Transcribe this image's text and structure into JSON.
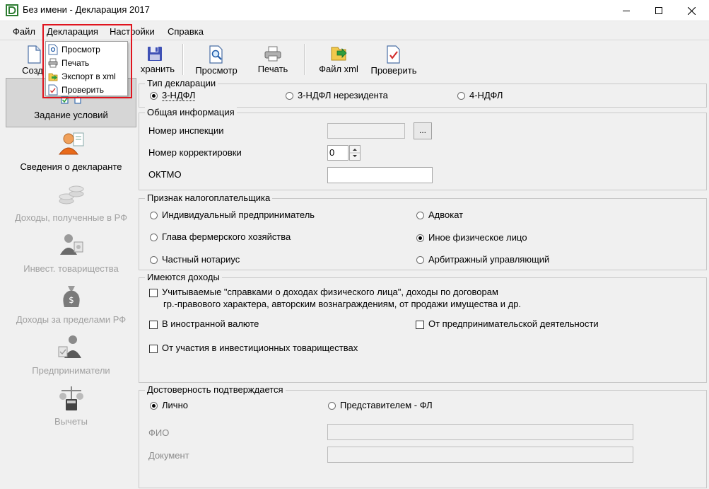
{
  "window": {
    "title": "Без имени - Декларация 2017",
    "controls": [
      "minimize",
      "maximize",
      "close"
    ]
  },
  "menubar": {
    "items": [
      "Файл",
      "Декларация",
      "Настройки",
      "Справка"
    ]
  },
  "dropdown": {
    "items": [
      {
        "label": "Просмотр",
        "icon": "preview-doc-icon"
      },
      {
        "label": "Печать",
        "icon": "printer-icon"
      },
      {
        "label": "Экспорт в xml",
        "icon": "export-xml-icon"
      },
      {
        "label": "Проверить",
        "icon": "check-doc-icon"
      }
    ]
  },
  "toolbar": {
    "create_label": "Созд",
    "save_label": "хранить",
    "preview_label": "Просмотр",
    "print_label": "Печать",
    "xml_label": "Файл xml",
    "check_label": "Проверить"
  },
  "leftnav": {
    "items": [
      {
        "label": "Задание условий",
        "enabled": true,
        "active": true
      },
      {
        "label": "Сведения о декларанте",
        "enabled": true,
        "active": false
      },
      {
        "label": "Доходы, полученные в РФ",
        "enabled": false,
        "active": false
      },
      {
        "label": "Инвест. товарищества",
        "enabled": false,
        "active": false
      },
      {
        "label": "Доходы за пределами РФ",
        "enabled": false,
        "active": false
      },
      {
        "label": "Предприниматели",
        "enabled": false,
        "active": false
      },
      {
        "label": "Вычеты",
        "enabled": false,
        "active": false
      }
    ]
  },
  "decl_type": {
    "title": "Тип декларации",
    "options": [
      "3-НДФЛ",
      "3-НДФЛ нерезидента",
      "4-НДФЛ"
    ],
    "selected": "3-НДФЛ"
  },
  "general": {
    "title": "Общая информация",
    "inspection_label": "Номер инспекции",
    "inspection_value": "",
    "browse_label": "...",
    "correction_label": "Номер корректировки",
    "correction_value": "0",
    "oktmo_label": "ОКТМО",
    "oktmo_value": ""
  },
  "taxpayer": {
    "title": "Признак налогоплательщика",
    "options": [
      "Индивидуальный предприниматель",
      "Адвокат",
      "Глава фермерского хозяйства",
      "Иное физическое лицо",
      "Частный нотариус",
      "Арбитражный управляющий"
    ],
    "selected": "Иное физическое лицо"
  },
  "income": {
    "title": "Имеются доходы",
    "item1_line1": "Учитываемые \"справками о доходах физического лица\", доходы по договорам",
    "item1_line2": "гр.-правового характера, авторским вознаграждениям, от продажи имущества и др.",
    "item2": "В иностранной валюте",
    "item3": "От предпринимательской деятельности",
    "item4": "От участия в инвестиционных товариществах",
    "checked": []
  },
  "confirm": {
    "title": "Достоверность подтверждается",
    "options": [
      "Лично",
      "Представителем - ФЛ"
    ],
    "selected": "Лично",
    "fio_label": "ФИО",
    "fio_value": "",
    "doc_label": "Документ",
    "doc_value": ""
  },
  "colors": {
    "highlight": "#e0141e",
    "disabled_text": "#a0a0a0",
    "window_bg": "#f0f0f0"
  }
}
